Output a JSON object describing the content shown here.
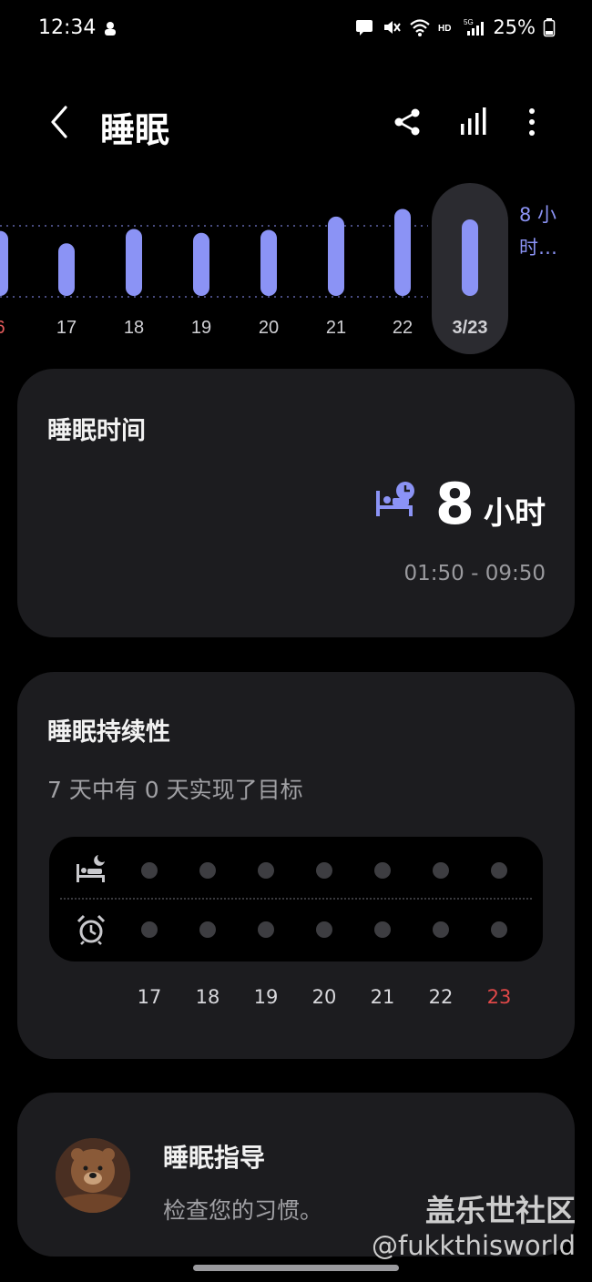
{
  "status_bar": {
    "time": "12:34",
    "battery": "25%",
    "icons": [
      "notification-icon",
      "message-icon",
      "mute-icon",
      "wifi-icon",
      "hd-icon",
      "signal-5g-icon",
      "battery-icon"
    ]
  },
  "header": {
    "title": "睡眠",
    "icons": [
      "back-icon",
      "share-icon",
      "chart-icon",
      "more-icon"
    ]
  },
  "chart_data": {
    "type": "bar",
    "categories": [
      "6",
      "17",
      "18",
      "19",
      "20",
      "21",
      "22",
      "3/23"
    ],
    "values": [
      6.8,
      5.5,
      7.0,
      6.6,
      6.9,
      8.3,
      9.1,
      8.0
    ],
    "goal_label": "8 小时…",
    "selected": "3/23",
    "colors": {
      "bar": "#8b93f5",
      "selected_bg": "#2b2b30",
      "first_label": "#e35b5b"
    }
  },
  "sleep_time": {
    "title": "睡眠时间",
    "value": "8",
    "unit": "小时",
    "range": "01:50 - 09:50"
  },
  "consistency": {
    "title": "睡眠持续性",
    "subtitle": "7 天中有 0 天实现了目标",
    "days": [
      "17",
      "18",
      "19",
      "20",
      "21",
      "22",
      "23"
    ],
    "today": "23",
    "rows": [
      "bed-icon",
      "alarm-icon"
    ]
  },
  "coaching": {
    "title": "睡眠指导",
    "subtitle": "检查您的习惯。"
  },
  "watermark": {
    "line1": "盖乐世社区",
    "line2": "@fukkthisworld"
  }
}
